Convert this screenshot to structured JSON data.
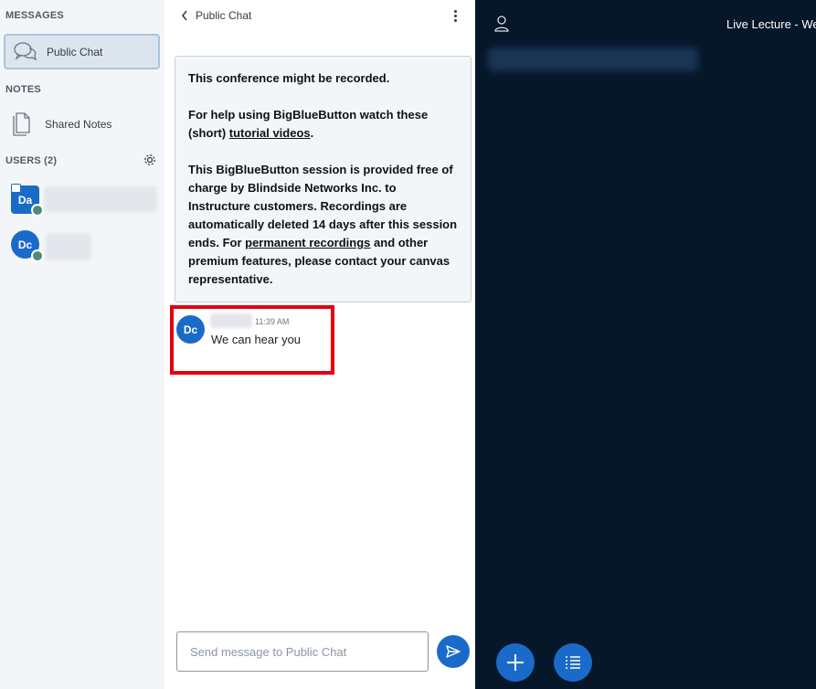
{
  "sidebar": {
    "messages_title": "MESSAGES",
    "public_chat_label": "Public Chat",
    "notes_title": "NOTES",
    "shared_notes_label": "Shared Notes",
    "users_title": "USERS (2)",
    "users": [
      {
        "initials": "Da",
        "shape": "square"
      },
      {
        "initials": "Dc",
        "shape": "round"
      }
    ]
  },
  "chat": {
    "header_title": "Public Chat",
    "welcome": {
      "line1": "This conference might be recorded.",
      "help_prefix": "For help using BigBlueButton watch these (short) ",
      "help_link": "tutorial videos",
      "help_suffix": ".",
      "provided_text": "This BigBlueButton session is provided free of charge by Blindside Networks Inc. to Instructure customers. ",
      "recordings_bold": "Recordings are automatically deleted 14 days after this session ends.",
      "for_text": " For ",
      "permanent_link": "permanent recordings",
      "contact_text": " and other premium features, please contact your canvas representative."
    },
    "message": {
      "initials": "Dc",
      "time": "11:39 AM",
      "text": "We can hear you"
    },
    "composer_placeholder": "Send message to Public Chat"
  },
  "main": {
    "title": "Live Lecture - Wec"
  },
  "colors": {
    "accent": "#1a6bc9",
    "dark_bg": "#06172a",
    "highlight": "#e3000f"
  }
}
